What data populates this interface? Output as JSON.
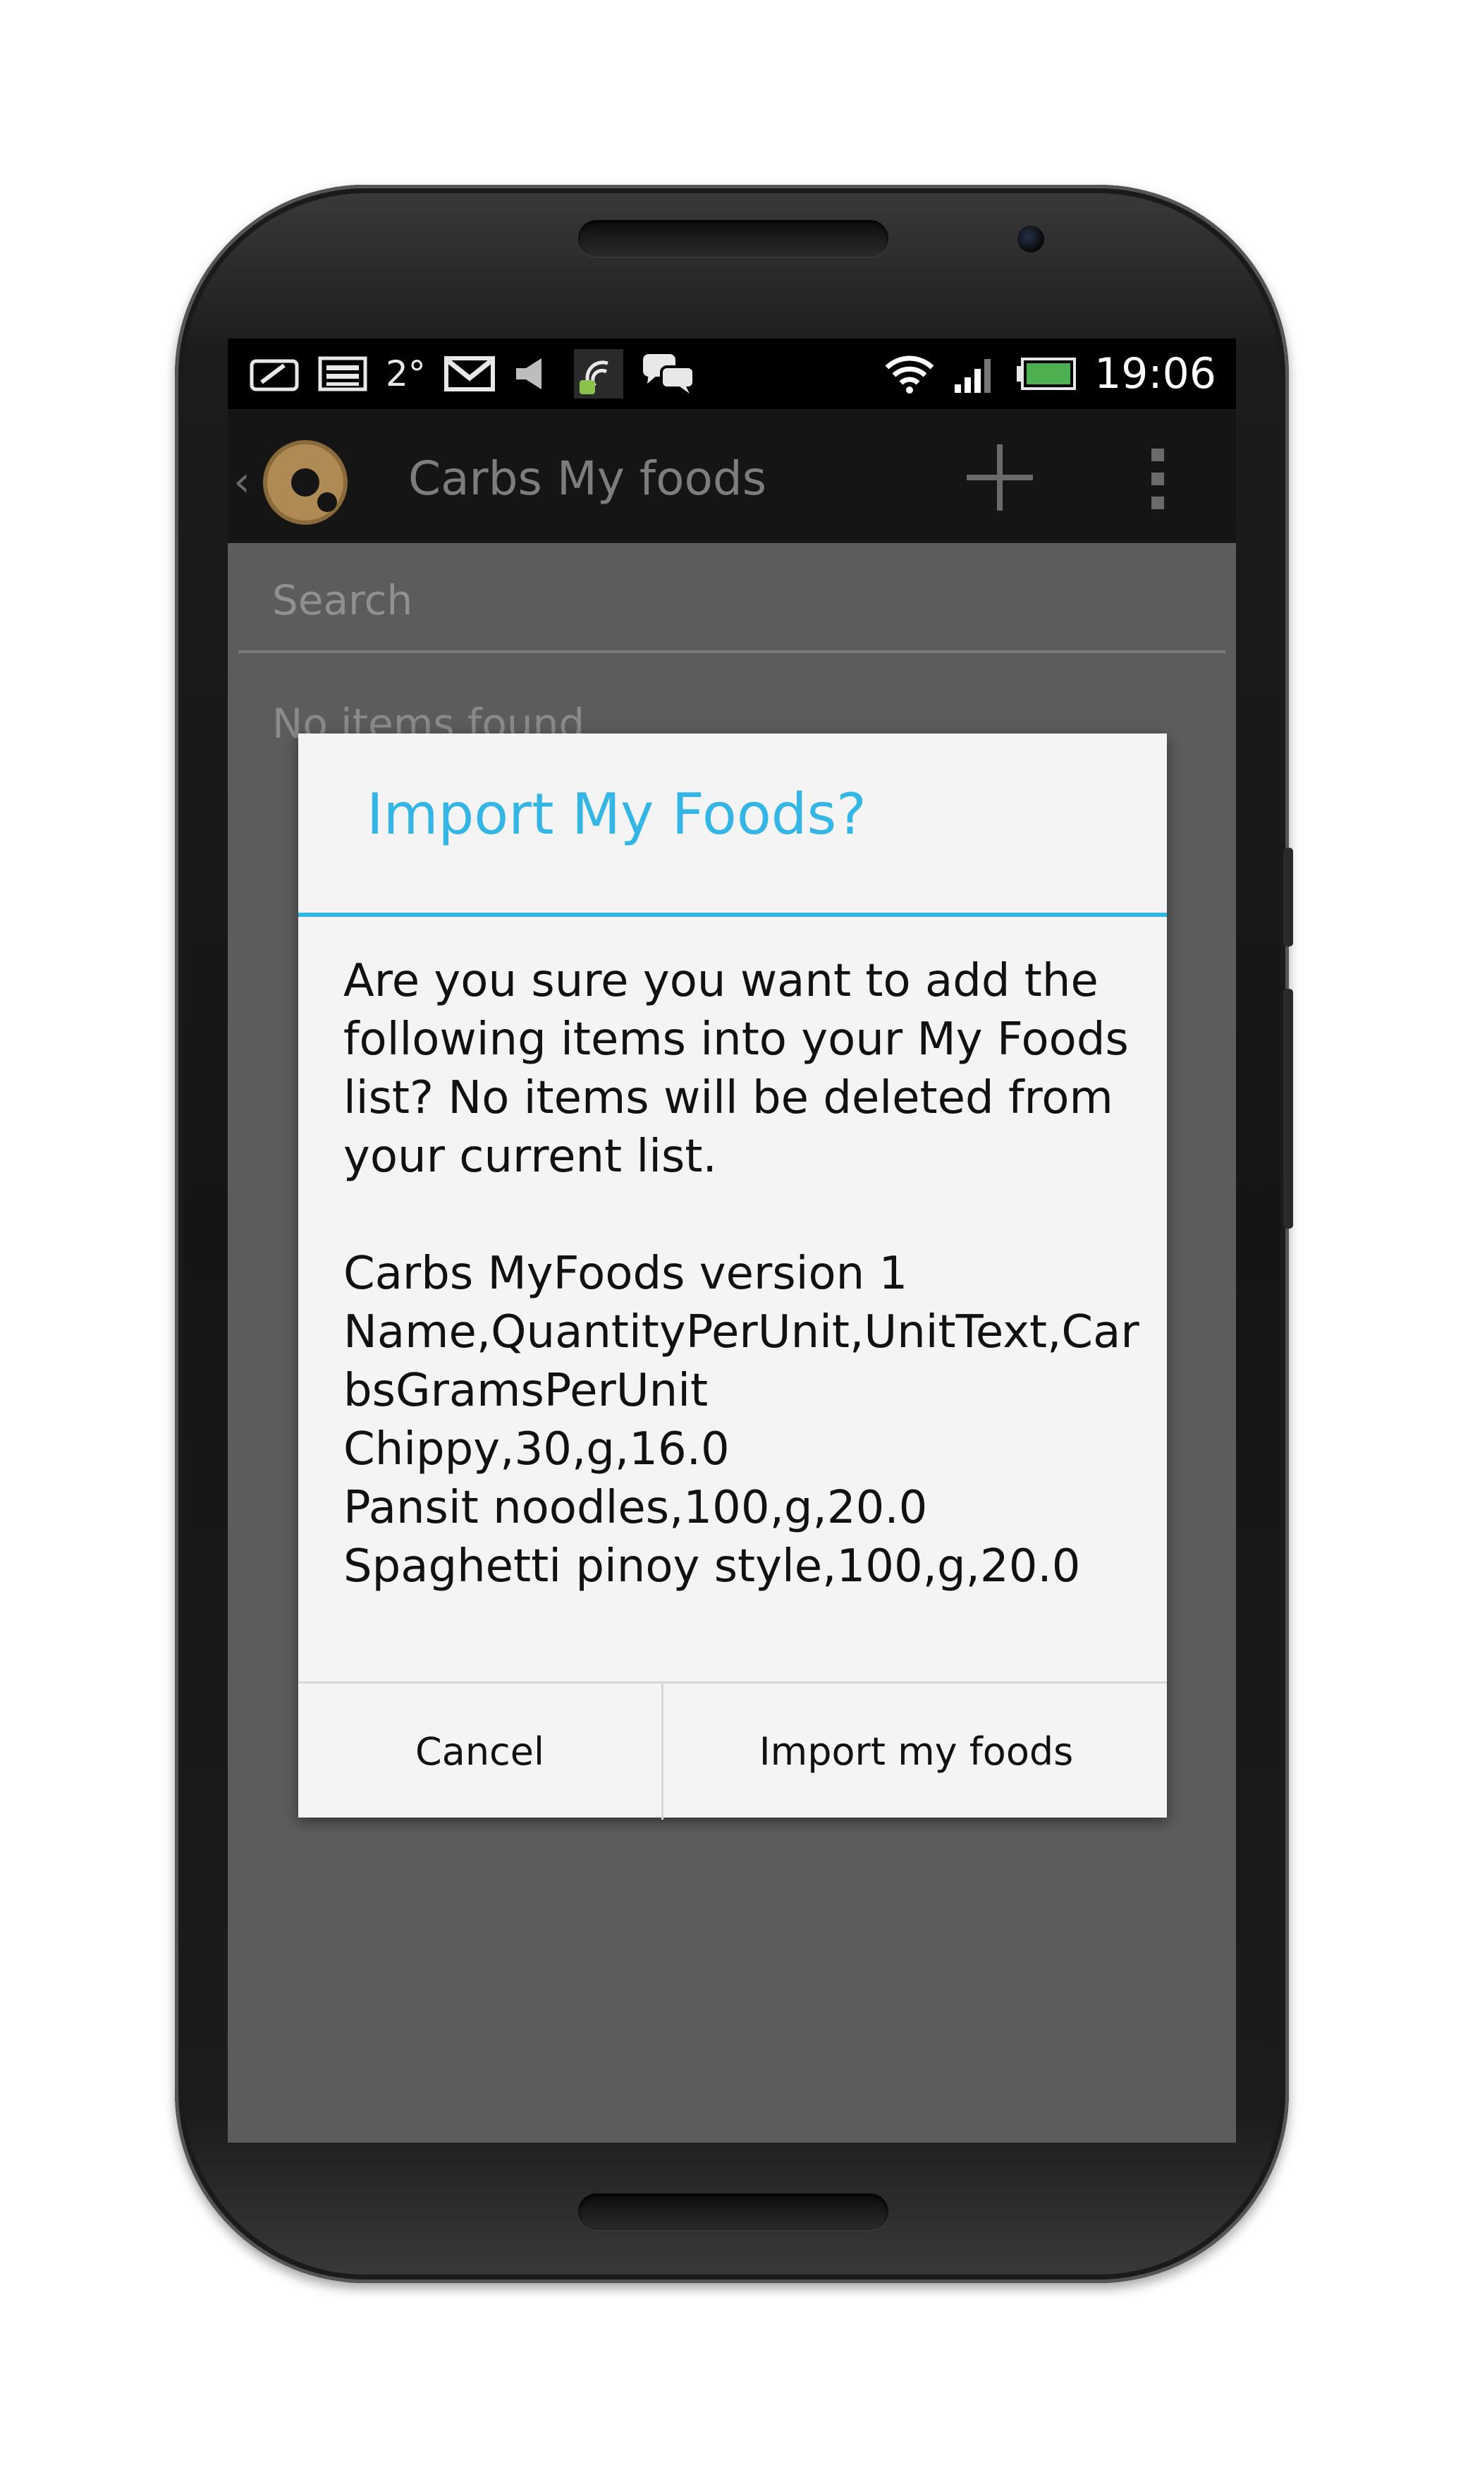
{
  "status_bar": {
    "left_icons": [
      "screenshot-icon",
      "photo-icon",
      "temperature",
      "gmail-icon",
      "volume-mute-icon",
      "android-sync-icon",
      "chat-icon"
    ],
    "temperature": "2°",
    "right_icons": [
      "wifi-icon",
      "signal-icon",
      "battery-icon"
    ],
    "time": "19:06"
  },
  "action_bar": {
    "title": "Carbs My foods",
    "actions": [
      "add-icon",
      "overflow-menu-icon"
    ]
  },
  "search": {
    "placeholder": "Search"
  },
  "list": {
    "empty_text": "No items found"
  },
  "dialog": {
    "title": "Import My Foods?",
    "message": "Are you sure you want to add the following items into your My Foods list? No items will be deleted from your current list.",
    "content_lines": [
      "Carbs MyFoods version 1",
      "Name,QuantityPerUnit,UnitText,CarbsGramsPerUnit",
      "Chippy,30,g,16.0",
      "Pansit noodles,100,g,20.0",
      "Spaghetti pinoy style,100,g,20.0"
    ],
    "cancel_label": "Cancel",
    "confirm_label": "Import my foods"
  },
  "colors": {
    "accent": "#33b5e5",
    "dim_background": "#5c5c5c",
    "dialog_background": "#f4f4f4"
  }
}
